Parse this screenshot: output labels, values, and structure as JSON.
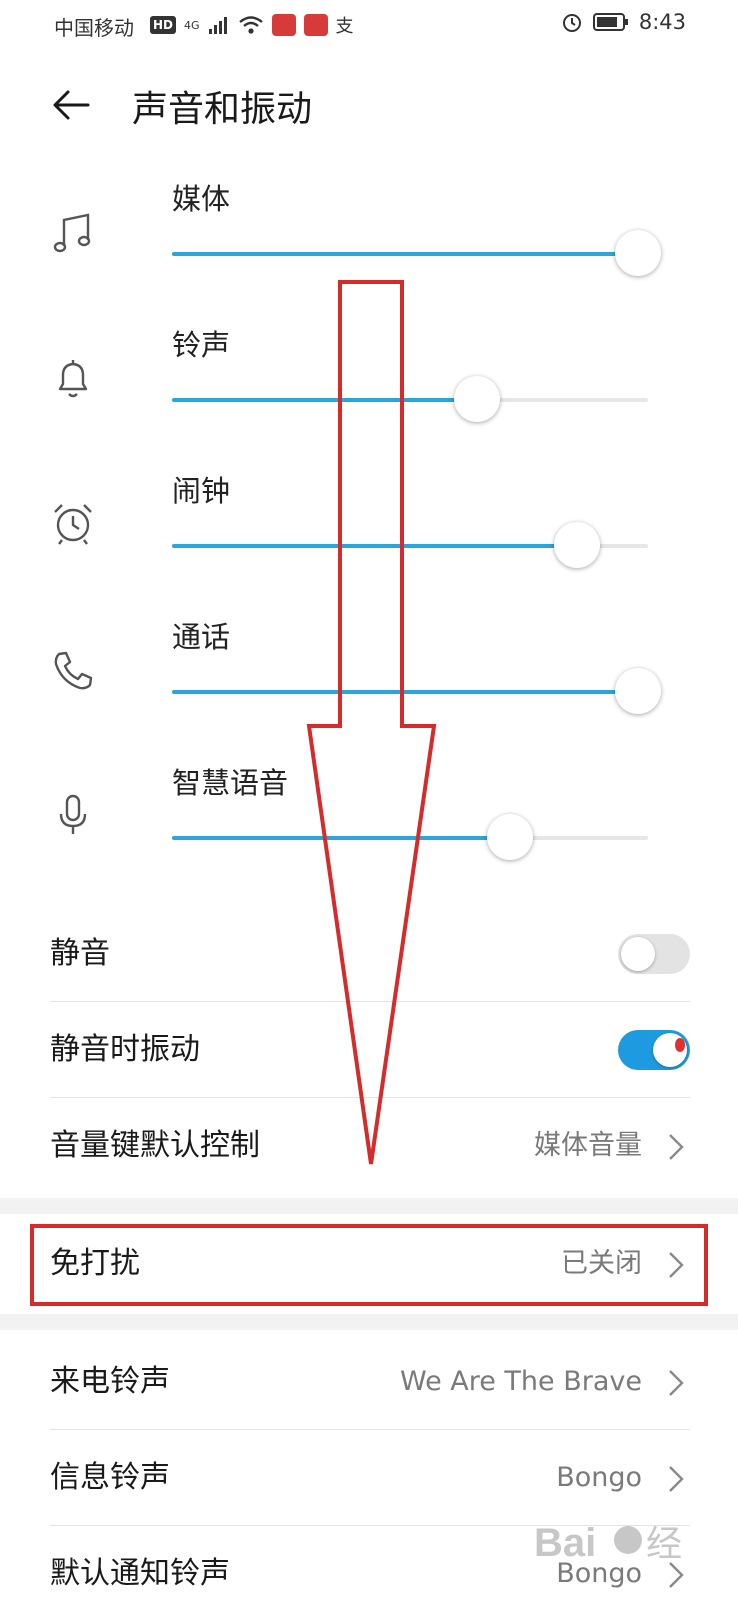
{
  "status_bar": {
    "carrier": "中国移动",
    "hd": "HD",
    "network": "4G",
    "alipay": "支",
    "time": "8:43"
  },
  "header": {
    "title": "声音和振动"
  },
  "volumes": [
    {
      "label": "媒体",
      "icon": "music-note-icon",
      "level": 1.0
    },
    {
      "label": "铃声",
      "icon": "bell-icon",
      "level": 0.64
    },
    {
      "label": "闹钟",
      "icon": "alarm-clock-icon",
      "level": 0.85
    },
    {
      "label": "通话",
      "icon": "phone-icon",
      "level": 1.0
    },
    {
      "label": "智慧语音",
      "icon": "microphone-icon",
      "level": 0.71
    }
  ],
  "rows": {
    "mute": {
      "label": "静音",
      "state": "off"
    },
    "vibrate_on_mute": {
      "label": "静音时振动",
      "state": "on"
    },
    "volume_key": {
      "label": "音量键默认控制",
      "value": "媒体音量"
    },
    "dnd": {
      "label": "免打扰",
      "value": "已关闭"
    },
    "ringtone": {
      "label": "来电铃声",
      "value": "We Are The Brave"
    },
    "message_tone": {
      "label": "信息铃声",
      "value": "Bongo"
    },
    "notification_tone": {
      "label": "默认通知铃声",
      "value": "Bongo"
    }
  },
  "colors": {
    "accent": "#2aa6dc",
    "toggle_on": "#1e9be0",
    "annotation_red": "#d52b2b"
  }
}
